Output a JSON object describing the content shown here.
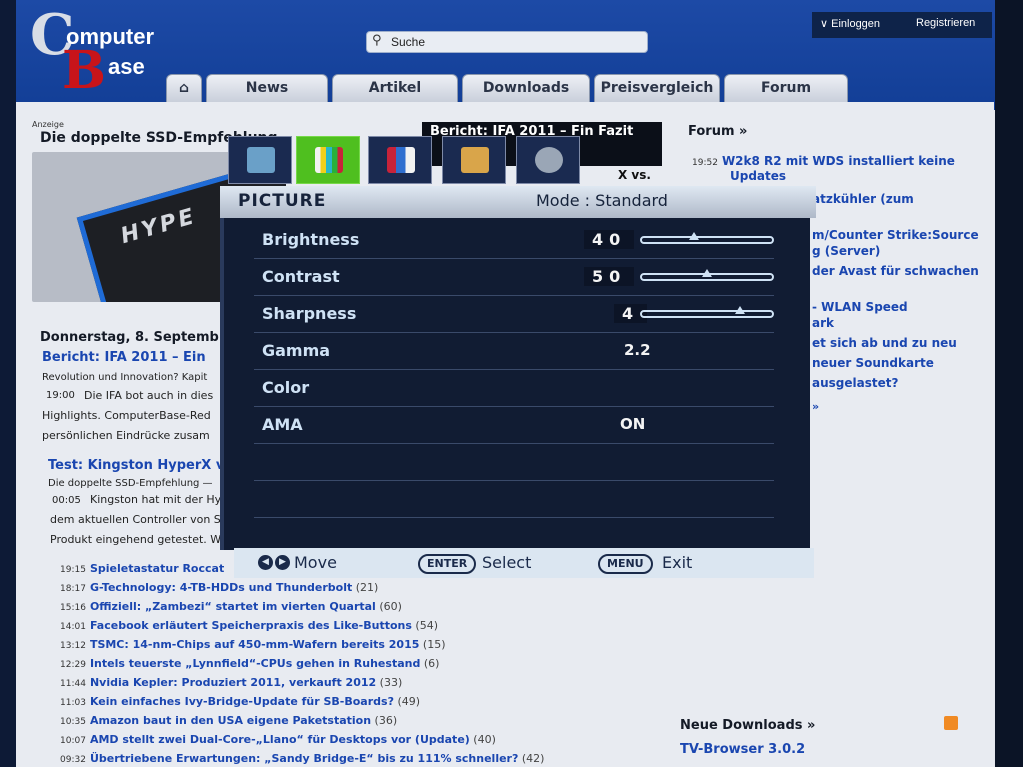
{
  "site": {
    "logo": {
      "c": "C",
      "omputer": "omputer",
      "b": "B",
      "ase": "ase"
    },
    "search_placeholder": "Suche",
    "account": {
      "login": "∨ Einloggen",
      "register": "Registrieren"
    },
    "nav": [
      "News",
      "Artikel",
      "Downloads",
      "Preisvergleich",
      "Forum"
    ],
    "ad": {
      "label": "Anzeige",
      "title": "Die doppelte SSD-Empfehlung",
      "brand": "HYPE"
    },
    "featured": {
      "headline": "Bericht: IFA 2011 – Fin Fazit",
      "snippet": "X vs."
    },
    "left_news": {
      "date": "Donnerstag, 8. Septemb",
      "n1_title": "Bericht: IFA 2011 – Ein",
      "n1_sub": "Revolution und Innovation? Kapit",
      "n1_time": "19:00",
      "n1_line1": "Die IFA bot auch in dies",
      "n1_line2": "Highlights. ComputerBase-Red",
      "n1_line3": "persönlichen Eindrücke zusam",
      "n2_title": "Test: Kingston HyperX v",
      "n2_sub": "Die doppelte SSD-Empfehlung —",
      "n2_time": "00:05",
      "n2_line1": "Kingston hat mit der Hy",
      "n2_line2": "dem aktuellen Controller von S",
      "n2_line3": "Produkt eingehend getestet. W"
    },
    "news_list": [
      {
        "time": "19:15",
        "title": "Spieletastatur Roccat",
        "count": ""
      },
      {
        "time": "18:17",
        "title": "G-Technology: 4-TB-HDDs und Thunderbolt",
        "count": "(21)"
      },
      {
        "time": "15:16",
        "title": "Offiziell: „Zambezi“ startet im vierten Quartal",
        "count": "(60)"
      },
      {
        "time": "14:01",
        "title": "Facebook erläutert Speicherpraxis des Like-Buttons",
        "count": "(54)"
      },
      {
        "time": "13:12",
        "title": "TSMC: 14-nm-Chips auf 450-mm-Wafern bereits 2015",
        "count": "(15)"
      },
      {
        "time": "12:29",
        "title": "Intels teuerste „Lynnfield“-CPUs gehen in Ruhestand",
        "count": "(6)"
      },
      {
        "time": "11:44",
        "title": "Nvidia Kepler: Produziert 2011, verkauft 2012",
        "count": "(33)"
      },
      {
        "time": "11:03",
        "title": "Kein einfaches Ivy-Bridge-Update für SB-Boards?",
        "count": "(49)"
      },
      {
        "time": "10:35",
        "title": "Amazon baut in den USA eigene Paketstation",
        "count": "(36)"
      },
      {
        "time": "10:07",
        "title": "AMD stellt zwei Dual-Core-„Llano“ für Desktops vor (Update)",
        "count": "(40)"
      },
      {
        "time": "09:32",
        "title": "Übertriebene Erwartungen: „Sandy Bridge-E“ bis zu 111% schneller?",
        "count": "(42)"
      }
    ],
    "forum": {
      "head": "Forum »",
      "i1_time": "19:52",
      "i1_l1": "W2k8 R2 mit WDS installiert keine",
      "i1_l2": "Updates",
      "i2": "atzkühler (zum",
      "i3_l1": "m/Counter Strike:Source",
      "i3_l2": "g (Server)",
      "i4": "der Avast für schwachen",
      "i5_l1": "- WLAN Speed",
      "i5_l2": "ark",
      "i6_l1": "et sich ab und zu neu",
      "i6_l2": "neuer Soundkarte",
      "i6_l3": "ausgelastet?",
      "more": "»"
    },
    "downloads": {
      "head": "Neue Downloads »",
      "item": "TV-Browser 3.0.2"
    }
  },
  "osd": {
    "title": "PICTURE",
    "mode_label": "Mode :",
    "mode_value": "Standard",
    "rows": [
      {
        "label": "Brightness",
        "value": "40",
        "level": 0.4
      },
      {
        "label": "Contrast",
        "value": "50",
        "level": 0.5
      },
      {
        "label": "Sharpness",
        "value": "4",
        "level": 0.75
      },
      {
        "label": "Gamma",
        "value": "2.2"
      },
      {
        "label": "Color",
        "value": ""
      },
      {
        "label": "AMA",
        "value": "ON"
      }
    ],
    "footer": {
      "move": "Move",
      "enter_key": "ENTER",
      "select": "Select",
      "menu_key": "MENU",
      "exit": "Exit"
    },
    "icons": [
      "display-settings-icon",
      "picture-icon",
      "picture-advanced-icon",
      "audio-icon",
      "system-icon"
    ]
  }
}
